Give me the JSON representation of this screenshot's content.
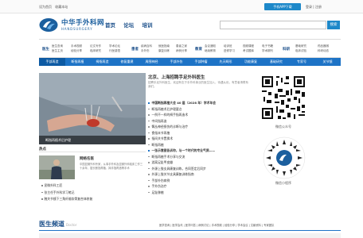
{
  "topbar": {
    "left_links": [
      "设为首页",
      "收藏本站"
    ],
    "app_button": "手机APP下载",
    "right_links": "登录 | 注册"
  },
  "logo": {
    "cn": "中华手外科网",
    "en": "HANDSURGERY"
  },
  "main_nav": [
    "首页",
    "论坛",
    "培训"
  ],
  "search": {
    "placeholder": "",
    "button": "搜索"
  },
  "categories": [
    {
      "title": "医生",
      "col1": [
        "医生查询",
        "医生主页"
      ],
      "col2": [
        "手术视频",
        "经验分享"
      ],
      "col3": [
        "论文写作",
        "临床研究"
      ],
      "col4": [
        "学术论坛",
        "行医感悟"
      ]
    },
    {
      "title": "患者",
      "col1": [
        "疾病百科",
        "手外伤"
      ],
      "col2": [
        "就医指南",
        "康复训练"
      ],
      "col3": [
        "患者之家",
        "病例分享"
      ]
    },
    {
      "title": "教育",
      "col1": [
        "会议通知",
        "继续教育"
      ],
      "col2": [
        "培训班",
        "进修学习"
      ],
      "col3": [
        "视频课程",
        "考试题库"
      ],
      "col4": [
        "电子书籍",
        "学术期刊"
      ]
    },
    {
      "title": "科研",
      "col1": [
        "基础研究",
        "临床试验"
      ],
      "col2": [
        "药品器械",
        "科研动态"
      ]
    }
  ],
  "blue_nav": [
    "手部再造",
    "断指再植",
    "拇指再造",
    "修复重建",
    "周围神经",
    "手部外伤",
    "手部肿瘤",
    "先天畸形",
    "功能康复",
    "基础研究",
    "专家号",
    "关节镜"
  ],
  "hero": {
    "caption": "断指再植术后护理"
  },
  "hot": {
    "heading": "热点",
    "title": "网络名医",
    "desc": "中国显微外科专家，从事手外科及显微外科临床工作三十余年，擅长断指再植、拇手指再造等手术",
    "list": [
      "显微外科工匠",
      "张主任手外科学习笔记",
      "腕关节镜下三角纤维软骨复合体修复"
    ]
  },
  "news": {
    "title": "北京、上海招聘手足外科医生",
    "desc": "招聘手足外科医生，欢迎有志于手外科事业的医生加入，待遇从优，有意者请联系我们。",
    "items": [
      {
        "text": "中国断指再植大会 40 届（2028 年）学术年会",
        "bold": true
      },
      {
        "text": "断指再植术后护理要点",
        "bold": false
      },
      {
        "text": "一例不一样的拇手指再造术",
        "bold": false
      },
      {
        "text": "中间指再造",
        "bold": false
      },
      {
        "text": "臂丛神经损伤的诊断与治疗",
        "bold": false
      },
      {
        "text": "食指末节再植",
        "bold": false
      },
      {
        "text": "指间关节置换术",
        "bold": false
      },
      {
        "text": "断指再植",
        "bold": false
      },
      {
        "text": "一张示意图告诉你，与一个时代的专业气质——",
        "bold": true
      },
      {
        "text": "断指再植手术分享与交流",
        "bold": false
      },
      {
        "text": "游离足趾甲皮瓣",
        "bold": false
      },
      {
        "text": "外源上肢支具康复训练，合同签定后同步",
        "bold": false
      },
      {
        "text": "外源上肢关节支具康复训练指南",
        "bold": false
      },
      {
        "text": "手部外伤病例",
        "bold": false
      },
      {
        "text": "手外伤治疗",
        "bold": false
      },
      {
        "text": "足趾移植",
        "bold": false
      }
    ]
  },
  "qr": {
    "caption1": "微信公众号",
    "caption2": "微信小程序"
  },
  "section": {
    "title": "医生频道",
    "subtitle": "Doctor",
    "links": "医学查询 | 医学会讯 | 医学问答 | 病例讨论 | 手术视频 | 经验分享 | 学术会议 | 文献资料 | 专家团队"
  },
  "colors": {
    "accent": "#1d73c6",
    "brand": "#1b4f8a"
  }
}
